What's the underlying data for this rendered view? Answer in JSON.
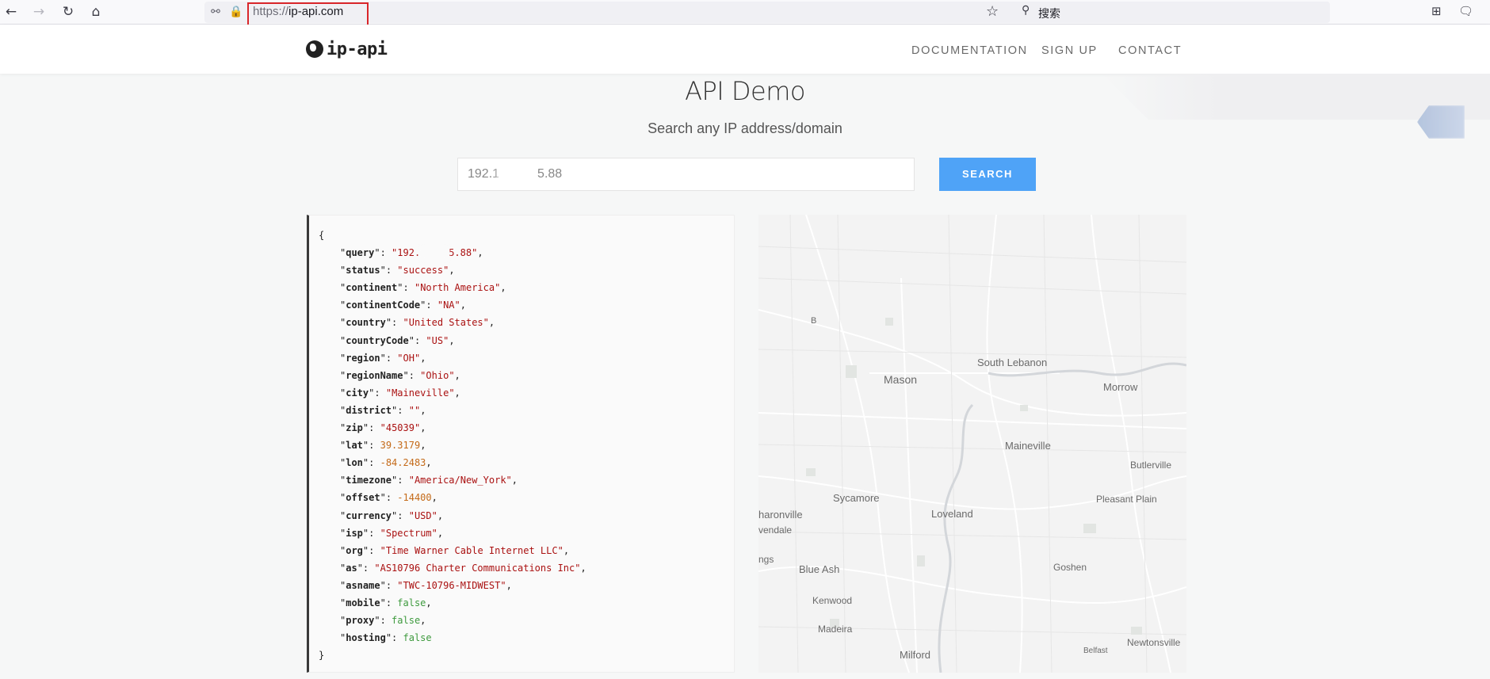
{
  "browser": {
    "url_scheme": "https://",
    "url_host": "ip-api.com",
    "search_placeholder": "搜索",
    "icons": [
      "back-icon",
      "forward-icon",
      "reload-icon",
      "home-icon",
      "shield-icon",
      "lock-icon",
      "star-icon",
      "search-icon",
      "crop-icon",
      "chat-icon"
    ]
  },
  "site": {
    "logo_text": "ip-api",
    "nav": [
      "DOCUMENTATION",
      "SIGN UP",
      "CONTACT"
    ]
  },
  "hero": {
    "title": "API Demo",
    "subtitle": "Search any IP address/domain",
    "input_prefix": "192.1",
    "input_suffix": "5.88",
    "search_label": "SEARCH"
  },
  "result": {
    "open": "{",
    "close": "}",
    "fields": [
      {
        "key": "query",
        "value": "192.",
        "value_suffix": "5.88",
        "type": "masked"
      },
      {
        "key": "status",
        "value": "success",
        "type": "string"
      },
      {
        "key": "continent",
        "value": "North America",
        "type": "string"
      },
      {
        "key": "continentCode",
        "value": "NA",
        "type": "string"
      },
      {
        "key": "country",
        "value": "United States",
        "type": "string"
      },
      {
        "key": "countryCode",
        "value": "US",
        "type": "string"
      },
      {
        "key": "region",
        "value": "OH",
        "type": "string"
      },
      {
        "key": "regionName",
        "value": "Ohio",
        "type": "string"
      },
      {
        "key": "city",
        "value": "Maineville",
        "type": "string"
      },
      {
        "key": "district",
        "value": "",
        "type": "string"
      },
      {
        "key": "zip",
        "value": "45039",
        "type": "string"
      },
      {
        "key": "lat",
        "value": "39.3179",
        "type": "number"
      },
      {
        "key": "lon",
        "value": "-84.2483",
        "type": "number"
      },
      {
        "key": "timezone",
        "value": "America/New_York",
        "type": "string"
      },
      {
        "key": "offset",
        "value": "-14400",
        "type": "number"
      },
      {
        "key": "currency",
        "value": "USD",
        "type": "string"
      },
      {
        "key": "isp",
        "value": "Spectrum",
        "type": "string"
      },
      {
        "key": "org",
        "value": "Time Warner Cable Internet LLC",
        "type": "string"
      },
      {
        "key": "as",
        "value": "AS10796 Charter Communications Inc",
        "type": "string"
      },
      {
        "key": "asname",
        "value": "TWC-10796-MIDWEST",
        "type": "string"
      },
      {
        "key": "mobile",
        "value": "false",
        "type": "bool"
      },
      {
        "key": "proxy",
        "value": "false",
        "type": "bool"
      },
      {
        "key": "hosting",
        "value": "false",
        "type": "bool"
      }
    ]
  },
  "map": {
    "labels": [
      "B",
      "South Lebanon",
      "Mason",
      "Morrow",
      "Maineville",
      "Butlerville",
      "Sycamore",
      "Pleasant Plain",
      "haronville",
      "Loveland",
      "vendale",
      "ngs",
      "Blue Ash",
      "Goshen",
      "Kenwood",
      "Madeira",
      "Milford",
      "Newtonsville",
      "Belfast"
    ]
  },
  "colors": {
    "accent": "#4fa3f7",
    "url_highlight": "#d9262a",
    "json_string": "#aa1111",
    "json_number": "#c46a18",
    "json_bool": "#3e9a3e"
  }
}
